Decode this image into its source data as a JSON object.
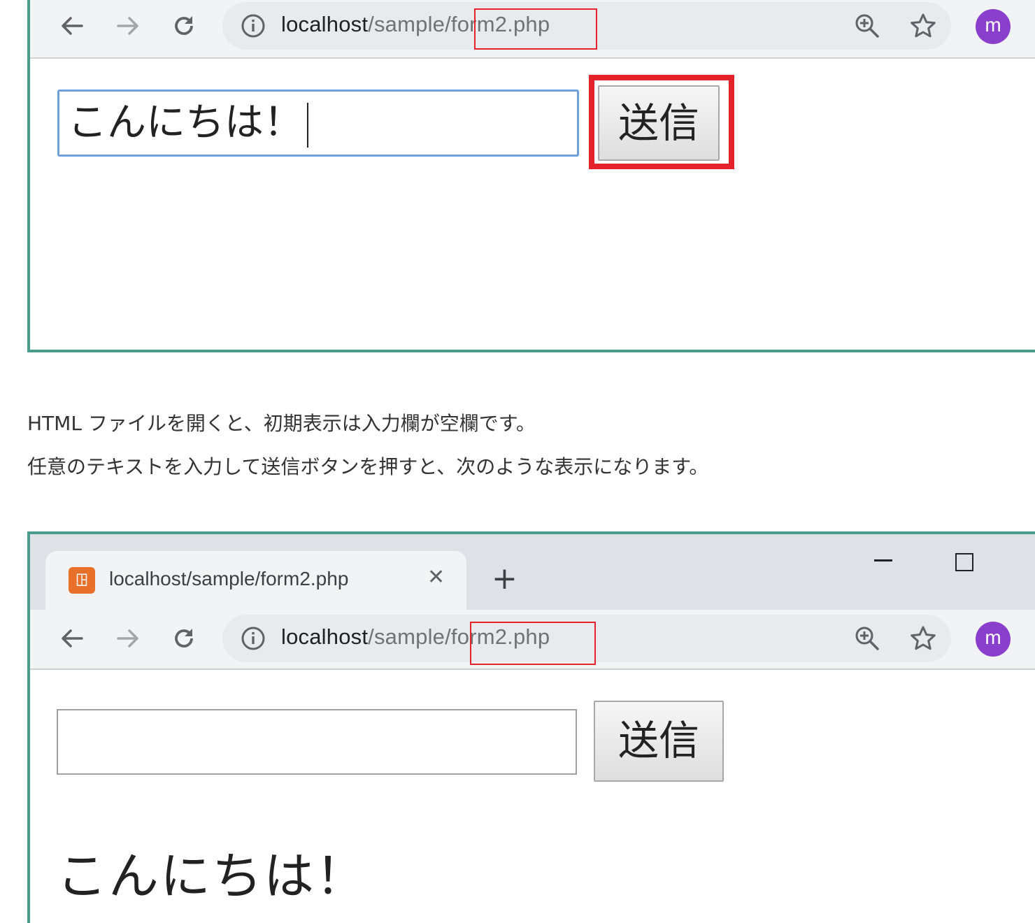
{
  "screenshot_top": {
    "address_bar": {
      "host": "localhost",
      "path": "/sample/form2.php",
      "highlight_text": "form2.php"
    },
    "avatar_letter": "m",
    "input_value": "こんにちは！",
    "submit_label": "送信"
  },
  "paragraphs": [
    "HTML ファイルを開くと、初期表示は入力欄が空欄です。",
    "任意のテキストを入力して送信ボタンを押すと、次のような表示になります。"
  ],
  "screenshot_bottom": {
    "tab": {
      "title": "localhost/sample/form2.php",
      "close_glyph": "✕",
      "favicon_icon": "xampp-favicon-icon"
    },
    "new_tab_glyph": "+",
    "address_bar": {
      "host": "localhost",
      "path": "/sample/form2.php",
      "highlight_text": "form2.php"
    },
    "avatar_letter": "m",
    "input_value": "",
    "submit_label": "送信",
    "output_text": "こんにちは！"
  },
  "colors": {
    "highlight_red": "#e4222c",
    "frame_border": "#4a9c8c",
    "avatar_purple": "#8a3fcc",
    "input_focus_blue": "#6fa0dd"
  }
}
